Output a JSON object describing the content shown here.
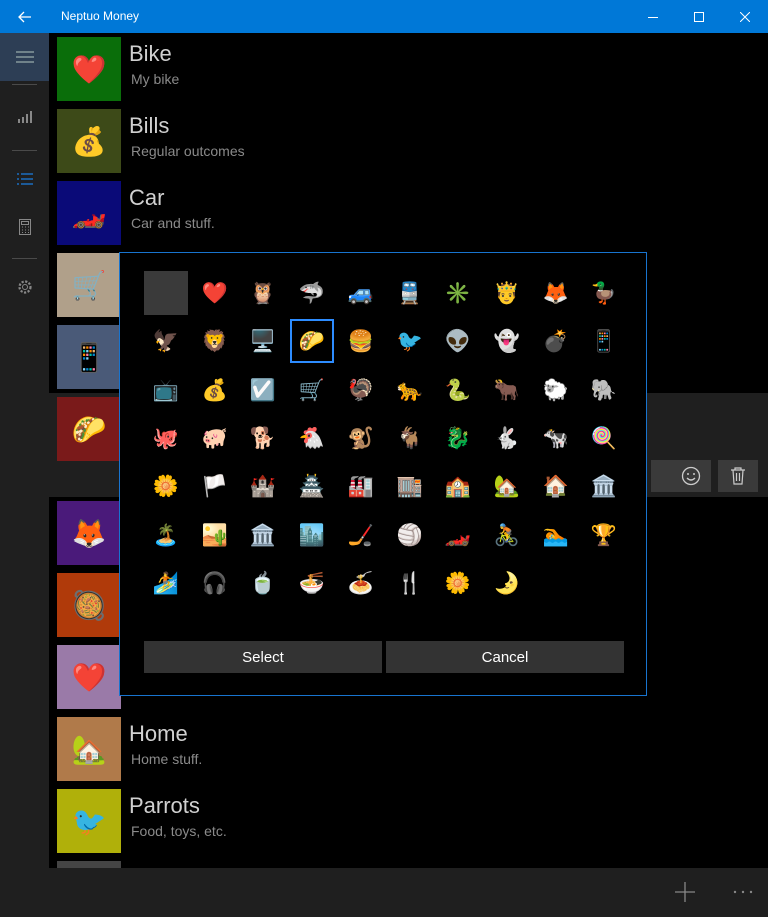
{
  "window": {
    "title": "Neptuo Money",
    "accent": "#0078d7"
  },
  "sidebar": {
    "items": [
      {
        "name": "hamburger-menu",
        "icon": "hamburger-icon"
      },
      {
        "name": "summary",
        "icon": "bar-chart-icon"
      },
      {
        "name": "categories",
        "icon": "list-icon"
      },
      {
        "name": "calculator",
        "icon": "calculator-icon"
      },
      {
        "name": "settings",
        "icon": "gear-icon"
      }
    ]
  },
  "categories": [
    {
      "name": "Bike",
      "description": "My bike",
      "icon": "❤️",
      "color": "#0a6e0a"
    },
    {
      "name": "Bills",
      "description": "Regular outcomes",
      "icon": "💰",
      "color": "#3d4a18"
    },
    {
      "name": "Car",
      "description": "Car and stuff.",
      "icon": "🏎️",
      "color": "#0a0a78"
    },
    {
      "name": "",
      "description": "",
      "icon": "🛒",
      "color": "#b0a08a"
    },
    {
      "name": "",
      "description": "",
      "icon": "📱",
      "color": "#4a5a78"
    },
    {
      "name": "",
      "description": "",
      "icon": "🌮",
      "color": "#7a1a1a"
    },
    {
      "name": "",
      "description": "",
      "icon": "🦊",
      "color": "#4a1a7a"
    },
    {
      "name": "",
      "description": "",
      "icon": "🥘",
      "color": "#b03a0a"
    },
    {
      "name": "",
      "description": "",
      "icon": "❤️",
      "color": "#9a7aa8"
    },
    {
      "name": "Home",
      "description": "Home stuff.",
      "icon": "🏡",
      "color": "#b07a4a"
    },
    {
      "name": "Parrots",
      "description": "Food, toys, etc.",
      "icon": "🐦",
      "color": "#b0b00a"
    }
  ],
  "dialog": {
    "icons": [
      "",
      "❤️",
      "🦉",
      "🦈",
      "🚙",
      "🚆",
      "✳️",
      "🤴",
      "🦊",
      "🦆",
      "🦅",
      "🦁",
      "🖥️",
      "🌮",
      "🍔",
      "🐦",
      "👽",
      "👻",
      "💣",
      "📱",
      "📺",
      "💰",
      "☑️",
      "🛒",
      "🦃",
      "🐆",
      "🐍",
      "🐂",
      "🐑",
      "🐘",
      "🐙",
      "🐖",
      "🐕",
      "🐔",
      "🐒",
      "🐐",
      "🐉",
      "🐇",
      "🐄",
      "🍭",
      "🌼",
      "🏳️",
      "🏰",
      "🏯",
      "🏭",
      "🏬",
      "🏫",
      "🏡",
      "🏠",
      "🏛️",
      "🏝️",
      "🏜️",
      "🏛️",
      "🏙️",
      "🏒",
      "🏐",
      "🏎️",
      "🚴",
      "🏊",
      "🏆",
      "🏄",
      "🎧",
      "🍵",
      "🍜",
      "🍝",
      "🍴",
      "🌼",
      "🌛"
    ],
    "selected_index": 13,
    "select_label": "Select",
    "cancel_label": "Cancel"
  }
}
